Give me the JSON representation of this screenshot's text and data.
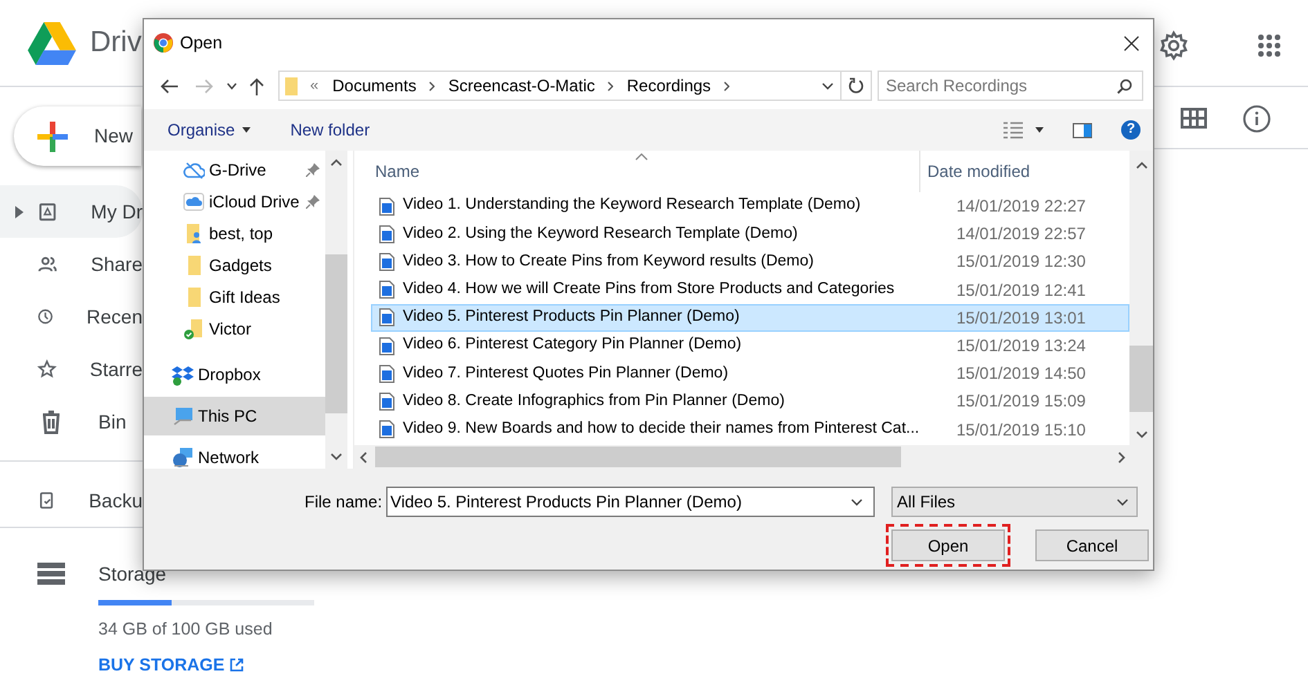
{
  "drive": {
    "logo_text": "Driv",
    "new_button": "New",
    "sidebar": [
      {
        "label": "My Dr",
        "kind": "drive",
        "selected": true,
        "expandable": true
      },
      {
        "label": "Share",
        "kind": "shared",
        "selected": false,
        "expandable": false
      },
      {
        "label": "Recen",
        "kind": "recent",
        "selected": false,
        "expandable": false
      },
      {
        "label": "Starre",
        "kind": "starred",
        "selected": false,
        "expandable": false
      },
      {
        "label": "Bin",
        "kind": "bin",
        "selected": false,
        "expandable": false
      },
      {
        "label": "Backu",
        "kind": "backup",
        "selected": false,
        "expandable": false
      }
    ],
    "storage": {
      "label": "Storage",
      "level": 0.34,
      "usage": "34 GB of 100 GB used",
      "buy": "BUY STORAGE"
    }
  },
  "dialog": {
    "title": "Open",
    "path_overflow": "«",
    "help": "?",
    "breadcrumb": [
      "Documents",
      "Screencast-O-Matic",
      "Recordings"
    ],
    "search_placeholder": "Search Recordings",
    "toolbar": {
      "organise": "Organise",
      "new_folder": "New folder"
    },
    "quick_access": [
      {
        "label": "G-Drive",
        "kind": "cloud",
        "pinned": true,
        "selected": false
      },
      {
        "label": "iCloud Drive",
        "kind": "icloud",
        "pinned": true,
        "selected": false
      },
      {
        "label": "best, top",
        "kind": "user-folder",
        "pinned": false,
        "selected": false
      },
      {
        "label": "Gadgets",
        "kind": "folder",
        "pinned": false,
        "selected": false
      },
      {
        "label": "Gift Ideas",
        "kind": "folder",
        "pinned": false,
        "selected": false
      },
      {
        "label": "Victor",
        "kind": "synced-folder",
        "pinned": false,
        "selected": false
      }
    ],
    "locations": [
      {
        "label": "Dropbox",
        "kind": "dropbox",
        "selected": false
      },
      {
        "label": "This PC",
        "kind": "pc",
        "selected": true
      },
      {
        "label": "Network",
        "kind": "network",
        "selected": false
      }
    ],
    "columns": [
      "Name",
      "Date modified"
    ],
    "files": [
      {
        "name": "Video 1. Understanding the Keyword Research Template (Demo)",
        "date": "14/01/2019 22:27",
        "selected": false
      },
      {
        "name": "Video 2. Using the Keyword Research Template (Demo)",
        "date": "14/01/2019 22:57",
        "selected": false
      },
      {
        "name": "Video 3. How to Create Pins from Keyword results (Demo)",
        "date": "15/01/2019 12:30",
        "selected": false
      },
      {
        "name": "Video 4. How we will Create Pins from Store Products and Categories",
        "date": "15/01/2019 12:41",
        "selected": false
      },
      {
        "name": "Video 5. Pinterest Products Pin Planner (Demo)",
        "date": "15/01/2019 13:01",
        "selected": true
      },
      {
        "name": "Video 6. Pinterest Category Pin Planner (Demo)",
        "date": "15/01/2019 13:24",
        "selected": false
      },
      {
        "name": "Video 7. Pinterest Quotes Pin Planner (Demo)",
        "date": "15/01/2019 14:50",
        "selected": false
      },
      {
        "name": "Video 8. Create Infographics from Pin Planner (Demo)",
        "date": "15/01/2019 15:09",
        "selected": false
      },
      {
        "name": "Video 9. New Boards and how to decide their names from Pinterest Cat...",
        "date": "15/01/2019 15:10",
        "selected": false
      }
    ],
    "file_name_label": "File name:",
    "file_name": "Video 5. Pinterest Products Pin Planner (Demo)",
    "file_type": "All Files",
    "buttons": [
      {
        "label": "Open",
        "highlighted": true
      },
      {
        "label": "Cancel",
        "highlighted": false
      }
    ]
  }
}
